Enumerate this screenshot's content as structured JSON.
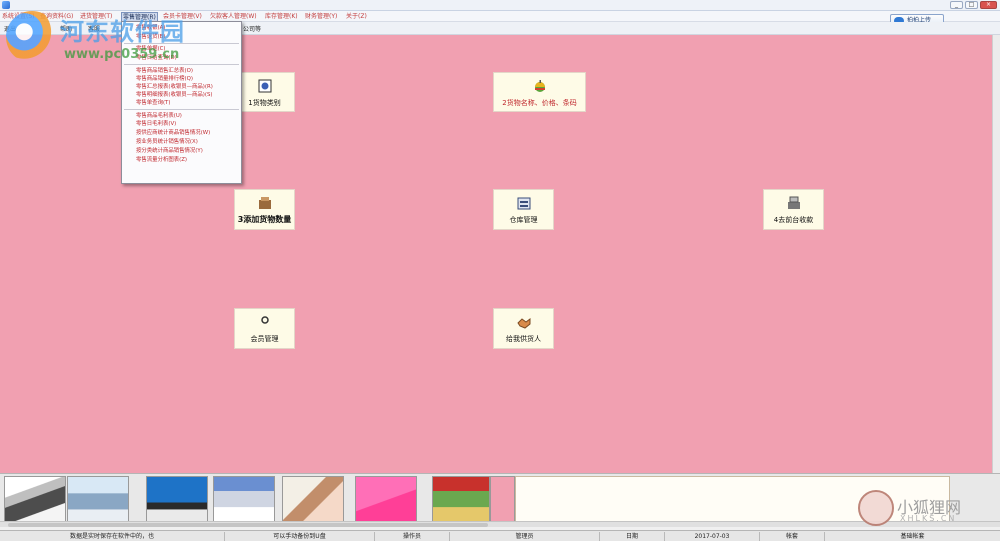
{
  "window": {
    "min": "_",
    "max": "□",
    "close": "×"
  },
  "menu": [
    {
      "label": "系统设置(S)"
    },
    {
      "label": "查询资料(G)"
    },
    {
      "label": "进货管理(T)"
    },
    {
      "label": "零售管理(R)"
    },
    {
      "label": "会员卡管理(V)"
    },
    {
      "label": "欠款客人管理(W)"
    },
    {
      "label": "库存管理(K)"
    },
    {
      "label": "财务管理(Y)"
    },
    {
      "label": "关于(Z)"
    }
  ],
  "cloud_button": "拍拍上传",
  "toolbar": [
    {
      "label": "退出"
    },
    {
      "label": "帮助"
    },
    {
      "label": "客服"
    },
    {
      "label": "公司等"
    }
  ],
  "dropdown": [
    "零售收银(A)",
    "零售退货(B)",
    "零售单据(C)",
    "零售日结查询(D)",
    "零售商品销售汇总表(O)",
    "零售商品销量排行榜(Q)",
    "零售汇总报表(收银员—商品)(R)",
    "零售明细报表(收银员—商品)(S)",
    "零售单查询(T)",
    "零售商品毛利表(U)",
    "零售日毛利表(V)",
    "按供应商统计商品销售情况(W)",
    "按业务员统计销售情况(X)",
    "按分类统计商品销售情况(Y)",
    "零售流量分析图表(Z)"
  ],
  "tiles": [
    {
      "label": "1货物类别"
    },
    {
      "label": "2货物名称、价格、条码"
    },
    {
      "label": "3添加货物数量"
    },
    {
      "label": "仓库管理"
    },
    {
      "label": "4去前台收款"
    },
    {
      "label": "会员管理"
    },
    {
      "label": "给我供货人"
    }
  ],
  "watermark": {
    "title": "河东软件园",
    "url": "www.pc0359.cn"
  },
  "status": [
    "数据是实时保存在软件中的，也",
    "可以手动备份到U盘",
    "操作员",
    "管理员",
    "日期",
    "2017-07-03",
    "帐套",
    "基础帐套"
  ],
  "corner_watermark": {
    "text": "小狐狸网",
    "sub": "XHLKS.CN"
  },
  "colors": {
    "desktop": "#f1a0b1",
    "tile": "#fefbe7",
    "menu_text": "#c23b3b"
  }
}
